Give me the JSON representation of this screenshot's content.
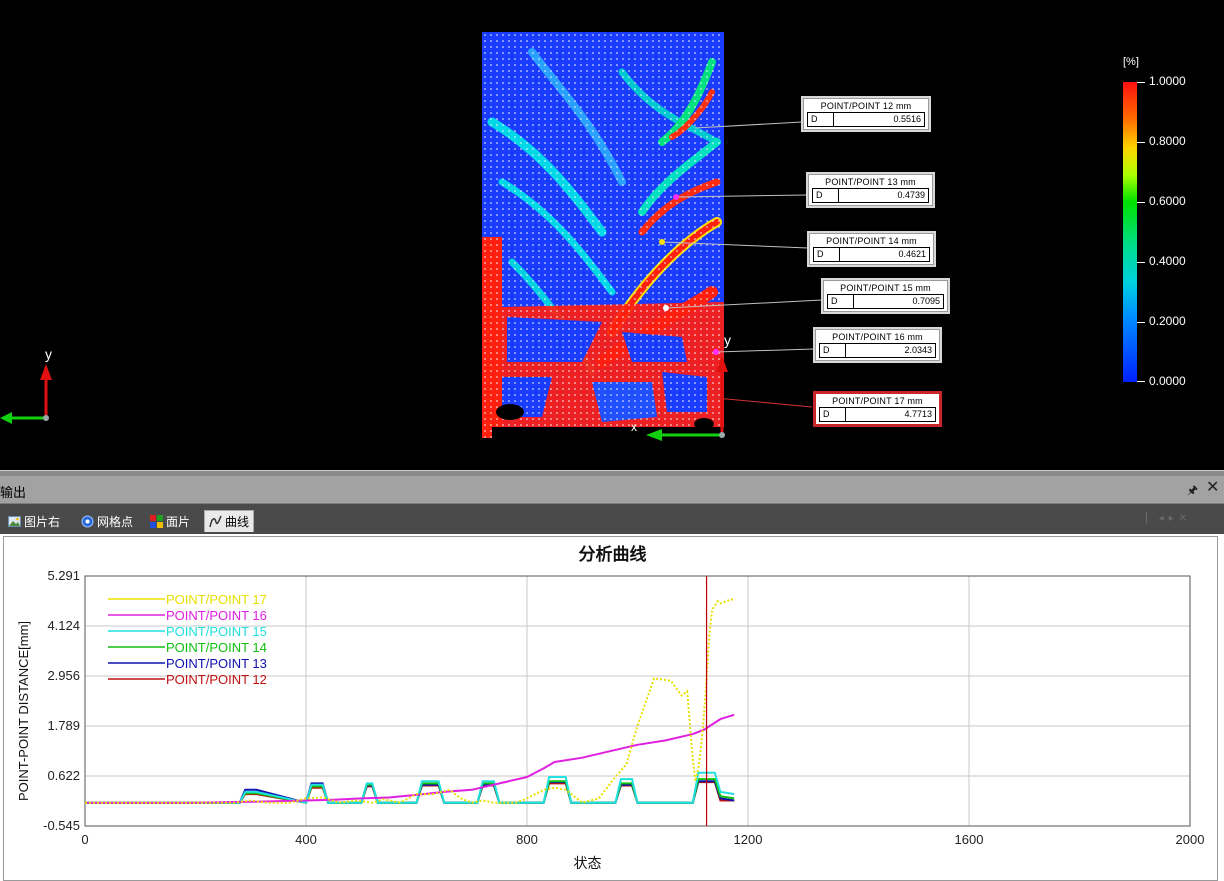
{
  "viewport": {
    "callouts": [
      {
        "title": "POINT/POINT 12 mm",
        "key": "D",
        "value": "0.5516",
        "selected": false
      },
      {
        "title": "POINT/POINT 13 mm",
        "key": "D",
        "value": "0.4739",
        "selected": false
      },
      {
        "title": "POINT/POINT 14 mm",
        "key": "D",
        "value": "0.4621",
        "selected": false
      },
      {
        "title": "POINT/POINT 15 mm",
        "key": "D",
        "value": "0.7095",
        "selected": false
      },
      {
        "title": "POINT/POINT 16 mm",
        "key": "D",
        "value": "2.0343",
        "selected": false
      },
      {
        "title": "POINT/POINT 17 mm",
        "key": "D",
        "value": "4.7713",
        "selected": true
      }
    ],
    "legend": {
      "unit": "[%]",
      "labels": [
        "1.0000",
        "0.8000",
        "0.6000",
        "0.4000",
        "0.2000",
        "0.0000"
      ]
    },
    "triad": {
      "y_label": "y",
      "local_y_label": "y",
      "local_x_label": "x"
    }
  },
  "panel": {
    "title": "输出",
    "pin_icon": "pin-icon",
    "close_icon": "close-icon",
    "tabs": [
      {
        "label": "图片右",
        "icon": "image-icon",
        "active": false
      },
      {
        "label": "网格点",
        "icon": "grid-point-icon",
        "active": false
      },
      {
        "label": "面片",
        "icon": "facet-icon",
        "active": false
      },
      {
        "label": "曲线",
        "icon": "curve-icon",
        "active": true
      }
    ]
  },
  "colors": {
    "POINT/POINT 17": "#e8e000",
    "POINT/POINT 16": "#e020e0",
    "POINT/POINT 15": "#20e0e0",
    "POINT/POINT 14": "#10c010",
    "POINT/POINT 13": "#1010b0",
    "POINT/POINT 12": "#c01010",
    "cursor": "#c00000"
  },
  "chart_data": {
    "type": "line",
    "title": "分析曲线",
    "xlabel": "状态",
    "ylabel": "POINT-POINT DISTANCE[mm]",
    "xlim": [
      0,
      2000
    ],
    "ylim": [
      -0.545,
      5.291
    ],
    "xticks": [
      "0",
      "400",
      "800",
      "1200",
      "1600",
      "2000"
    ],
    "yticks": [
      "5.291",
      "4.124",
      "2.956",
      "1.789",
      "0.622",
      "-0.545"
    ],
    "grid": true,
    "legend_position": "top-left",
    "cursor_x": 1125,
    "series": [
      {
        "name": "POINT/POINT 17",
        "x": [
          0,
          200,
          270,
          300,
          330,
          370,
          400,
          430,
          460,
          490,
          520,
          540,
          570,
          600,
          630,
          660,
          680,
          700,
          720,
          740,
          760,
          780,
          800,
          830,
          850,
          870,
          900,
          930,
          960,
          980,
          1000,
          1030,
          1060,
          1080,
          1090,
          1100,
          1105,
          1110,
          1115,
          1120,
          1125,
          1130,
          1135,
          1140,
          1145,
          1150,
          1160,
          1170,
          1175
        ],
        "y": [
          0,
          0,
          0,
          0.05,
          0,
          0,
          0.1,
          0.12,
          0,
          0.05,
          0,
          0.08,
          0,
          0.2,
          0.2,
          0.3,
          0.1,
          0,
          0.05,
          0,
          0,
          0,
          0.1,
          0.3,
          0.35,
          0.3,
          0,
          0.1,
          0.6,
          0.9,
          1.8,
          2.9,
          2.85,
          2.5,
          2.6,
          1.0,
          0.5,
          0.8,
          1.3,
          2.0,
          2.9,
          3.9,
          4.5,
          4.6,
          4.7,
          4.65,
          4.7,
          4.75,
          4.7
        ]
      },
      {
        "name": "POINT/POINT 16",
        "x": [
          0,
          100,
          200,
          300,
          400,
          450,
          500,
          550,
          600,
          650,
          700,
          750,
          800,
          830,
          850,
          900,
          950,
          1000,
          1050,
          1100,
          1120,
          1150,
          1175
        ],
        "y": [
          0,
          0,
          0,
          0.02,
          0.05,
          0.07,
          0.1,
          0.12,
          0.18,
          0.25,
          0.3,
          0.45,
          0.6,
          0.8,
          0.95,
          1.05,
          1.2,
          1.35,
          1.45,
          1.6,
          1.7,
          1.95,
          2.05
        ]
      },
      {
        "name": "POINT/POINT 15",
        "x": [
          0,
          280,
          290,
          310,
          400,
          410,
          430,
          440,
          500,
          510,
          520,
          530,
          600,
          610,
          640,
          650,
          710,
          720,
          740,
          750,
          830,
          840,
          870,
          880,
          960,
          970,
          990,
          1000,
          1100,
          1110,
          1140,
          1150,
          1175
        ],
        "y": [
          0,
          0,
          0.25,
          0.25,
          0,
          0.42,
          0.42,
          0,
          0,
          0.45,
          0.45,
          0,
          0,
          0.5,
          0.5,
          0,
          0,
          0.5,
          0.5,
          0,
          0,
          0.6,
          0.6,
          0,
          0,
          0.55,
          0.55,
          0,
          0,
          0.7,
          0.7,
          0.25,
          0.2
        ]
      },
      {
        "name": "POINT/POINT 14",
        "x": [
          0,
          280,
          290,
          310,
          400,
          410,
          430,
          440,
          500,
          510,
          520,
          530,
          600,
          610,
          640,
          650,
          710,
          720,
          740,
          750,
          830,
          840,
          870,
          880,
          960,
          970,
          990,
          1000,
          1100,
          1110,
          1140,
          1150,
          1175
        ],
        "y": [
          0,
          0,
          0.22,
          0.22,
          0,
          0.38,
          0.38,
          0,
          0,
          0.42,
          0.42,
          0,
          0,
          0.45,
          0.45,
          0,
          0,
          0.45,
          0.45,
          0,
          0,
          0.5,
          0.5,
          0,
          0,
          0.45,
          0.45,
          0,
          0,
          0.55,
          0.55,
          0.15,
          0.1
        ]
      },
      {
        "name": "POINT/POINT 13",
        "x": [
          0,
          280,
          290,
          310,
          400,
          410,
          430,
          440,
          500,
          510,
          520,
          530,
          600,
          610,
          640,
          650,
          710,
          720,
          740,
          750,
          830,
          840,
          870,
          880,
          960,
          970,
          990,
          1000,
          1100,
          1110,
          1140,
          1150,
          1175
        ],
        "y": [
          0,
          0,
          0.3,
          0.3,
          0,
          0.45,
          0.45,
          0,
          0,
          0.4,
          0.4,
          0,
          0,
          0.42,
          0.42,
          0,
          0,
          0.42,
          0.42,
          0,
          0,
          0.48,
          0.48,
          0,
          0,
          0.42,
          0.42,
          0,
          0,
          0.5,
          0.5,
          0.1,
          0.05
        ]
      },
      {
        "name": "POINT/POINT 12",
        "x": [
          0,
          280,
          290,
          310,
          400,
          410,
          430,
          440,
          500,
          510,
          520,
          530,
          600,
          610,
          640,
          650,
          710,
          720,
          740,
          750,
          830,
          840,
          870,
          880,
          960,
          970,
          990,
          1000,
          1100,
          1110,
          1140,
          1150,
          1175
        ],
        "y": [
          0,
          0,
          0.2,
          0.2,
          0,
          0.35,
          0.35,
          0,
          0,
          0.38,
          0.38,
          0,
          0,
          0.4,
          0.4,
          0,
          0,
          0.4,
          0.4,
          0,
          0,
          0.45,
          0.45,
          0,
          0,
          0.4,
          0.4,
          0,
          0,
          0.48,
          0.48,
          0.05,
          0.05
        ]
      }
    ]
  }
}
